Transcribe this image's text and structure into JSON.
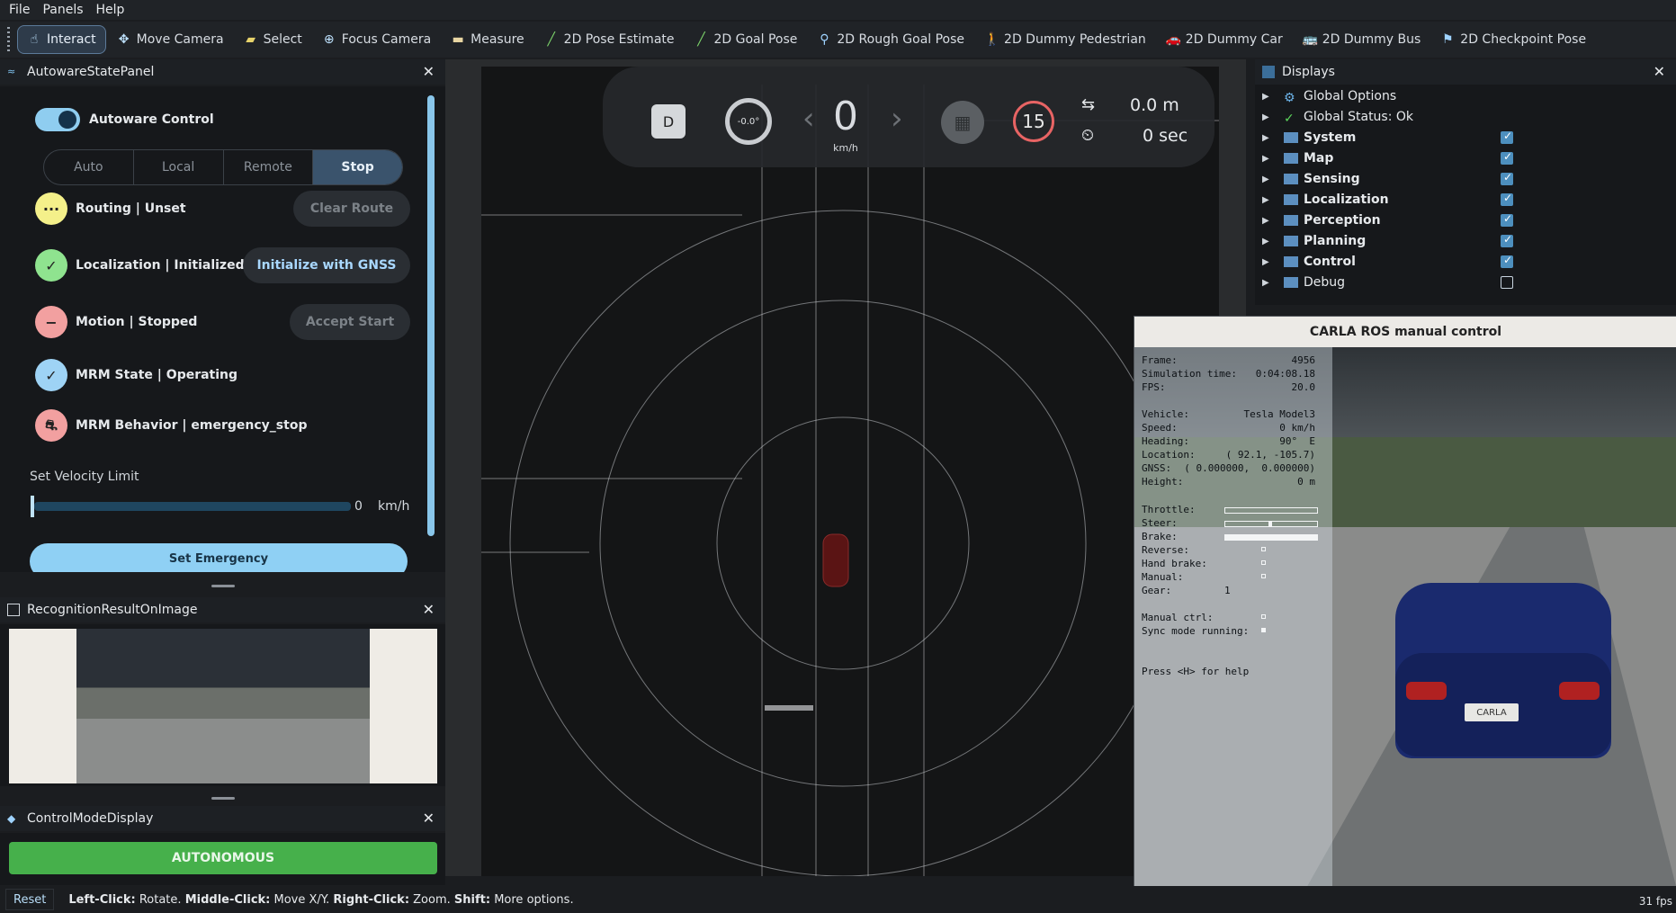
{
  "menubar": {
    "items": [
      "File",
      "Panels",
      "Help"
    ]
  },
  "toolbar": {
    "tools": [
      {
        "label": "Interact",
        "icon": "cursor-icon"
      },
      {
        "label": "Move Camera",
        "icon": "move-icon"
      },
      {
        "label": "Select",
        "icon": "select-icon"
      },
      {
        "label": "Focus Camera",
        "icon": "focus-icon"
      },
      {
        "label": "Measure",
        "icon": "ruler-icon"
      },
      {
        "label": "2D Pose Estimate",
        "icon": "pose-arrow-icon"
      },
      {
        "label": "2D Goal Pose",
        "icon": "goal-arrow-icon"
      },
      {
        "label": "2D Rough Goal Pose",
        "icon": "map-pin-icon"
      },
      {
        "label": "2D Dummy Pedestrian",
        "icon": "pedestrian-icon"
      },
      {
        "label": "2D Dummy Car",
        "icon": "car-icon"
      },
      {
        "label": "2D Dummy Bus",
        "icon": "bus-icon"
      },
      {
        "label": "2D Checkpoint Pose",
        "icon": "flag-icon"
      }
    ]
  },
  "autoware_panel": {
    "title": "AutowareStatePanel",
    "control_label": "Autoware Control",
    "modes": [
      "Auto",
      "Local",
      "Remote",
      "Stop"
    ],
    "routing": {
      "text": "Routing | Unset",
      "button": "Clear Route"
    },
    "localization": {
      "text": "Localization | Initialized",
      "button": "Initialize with GNSS"
    },
    "motion": {
      "text": "Motion | Stopped",
      "button": "Accept Start"
    },
    "mrm_state": {
      "text": "MRM State | Operating"
    },
    "mrm_behavior": {
      "text": "MRM Behavior | emergency_stop"
    },
    "velocity": {
      "label": "Set Velocity Limit",
      "value": "0",
      "unit": "km/h"
    },
    "emergency_button": "Set Emergency"
  },
  "recognition_panel": {
    "title": "RecognitionResultOnImage"
  },
  "control_mode_panel": {
    "title": "ControlModeDisplay",
    "mode": "AUTONOMOUS"
  },
  "status_bar": {
    "reset": "Reset",
    "left_click_key": "Left-Click:",
    "left_click_val": "Rotate.",
    "middle_click_key": "Middle-Click:",
    "middle_click_val": "Move X/Y.",
    "right_click_key": "Right-Click:",
    "right_click_val": "Zoom.",
    "shift_key": "Shift:",
    "shift_val": "More options.",
    "fps": "31 fps"
  },
  "hud": {
    "gear": "D",
    "steering": "-0.0°",
    "speed": "0",
    "speed_unit": "km/h",
    "speed_limit": "15",
    "distance": "0.0 m",
    "time": "0 sec"
  },
  "displays_panel": {
    "title": "Displays",
    "items": [
      {
        "name": "Global Options",
        "checkbox": null
      },
      {
        "name": "Global Status: Ok",
        "checkbox": null
      },
      {
        "name": "System",
        "checkbox": true
      },
      {
        "name": "Map",
        "checkbox": true
      },
      {
        "name": "Sensing",
        "checkbox": true
      },
      {
        "name": "Localization",
        "checkbox": true
      },
      {
        "name": "Perception",
        "checkbox": true
      },
      {
        "name": "Planning",
        "checkbox": true
      },
      {
        "name": "Control",
        "checkbox": true
      },
      {
        "name": "Debug",
        "checkbox": false
      }
    ]
  },
  "carla": {
    "title": "CARLA ROS manual control",
    "lines": [
      {
        "k": "Frame:",
        "v": "4956"
      },
      {
        "k": "Simulation time:",
        "v": "0:04:08.18"
      },
      {
        "k": "FPS:",
        "v": "20.0"
      },
      {
        "k": "Vehicle:",
        "v": "Tesla Model3"
      },
      {
        "k": "Speed:",
        "v": "0 km/h"
      },
      {
        "k": "Heading:",
        "v": "90°  E"
      },
      {
        "k": "Location:",
        "v": "( 92.1, -105.7)"
      },
      {
        "k": "GNSS:",
        "v": "( 0.000000,  0.000000)"
      },
      {
        "k": "Height:",
        "v": "0 m"
      },
      {
        "k": "Throttle:",
        "v": ""
      },
      {
        "k": "Steer:",
        "v": ""
      },
      {
        "k": "Brake:",
        "v": ""
      },
      {
        "k": "Reverse:",
        "v": ""
      },
      {
        "k": "Hand brake:",
        "v": ""
      },
      {
        "k": "Manual:",
        "v": ""
      },
      {
        "k": "Gear:",
        "v": "1"
      },
      {
        "k": "Manual ctrl:",
        "v": ""
      },
      {
        "k": "Sync mode running:",
        "v": ""
      },
      {
        "k": "Press <H> for help",
        "v": ""
      }
    ],
    "throttle": 0.0,
    "steer": 0.5,
    "brake": 1.0,
    "plate": "CARLA"
  },
  "colors": {
    "accent": "#8fcdf0",
    "autonomous": "#46b04b",
    "limit": "#e86464"
  }
}
